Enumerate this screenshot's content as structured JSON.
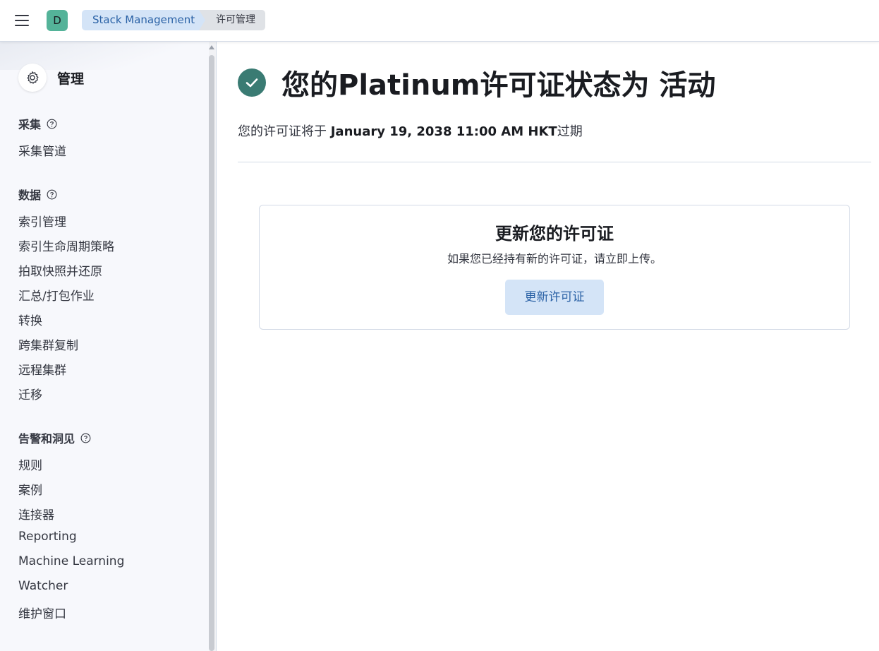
{
  "header": {
    "space_initial": "D",
    "breadcrumbs": [
      "Stack Management",
      "许可管理"
    ]
  },
  "sidebar": {
    "title": "管理",
    "groups": [
      {
        "title": "采集",
        "items": [
          "采集管道"
        ]
      },
      {
        "title": "数据",
        "items": [
          "索引管理",
          "索引生命周期策略",
          "拍取快照并还原",
          "汇总/打包作业",
          "转换",
          "跨集群复制",
          "远程集群",
          "迁移"
        ]
      },
      {
        "title": "告警和洞见",
        "items": [
          "规则",
          "案例",
          "连接器",
          "Reporting",
          "Machine Learning",
          "Watcher",
          "维护窗口"
        ]
      }
    ]
  },
  "main": {
    "title": "您的Platinum许可证状态为 活动",
    "expiry_prefix": "您的许可证将于 ",
    "expiry_date": "January 19, 2038 11:00 AM HKT",
    "expiry_suffix": "过期",
    "status_color": "#3a7b73",
    "card": {
      "title": "更新您的许可证",
      "description": "如果您已经持有新的许可证，请立即上传。",
      "button_label": "更新许可证"
    }
  }
}
